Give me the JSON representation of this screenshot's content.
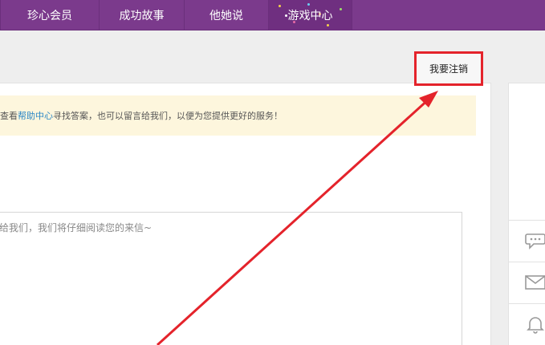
{
  "nav": {
    "items": [
      {
        "label": "珍心会员"
      },
      {
        "label": "成功故事"
      },
      {
        "label": "他她说"
      },
      {
        "label": "游戏中心"
      }
    ],
    "bg_color": "#7b3a8c"
  },
  "logout": {
    "label": "我要注销",
    "highlight_color": "#e4232b"
  },
  "notice": {
    "prefix": "查看",
    "link": "帮助中心",
    "suffix": "寻找答案，也可以留言给我们，以便为您提供更好的服务！"
  },
  "message": {
    "placeholder": "给我们，我们将仔细阅读您的来信~"
  },
  "side": {
    "icons": [
      "chat-icon",
      "mail-icon",
      "bell-icon"
    ]
  }
}
